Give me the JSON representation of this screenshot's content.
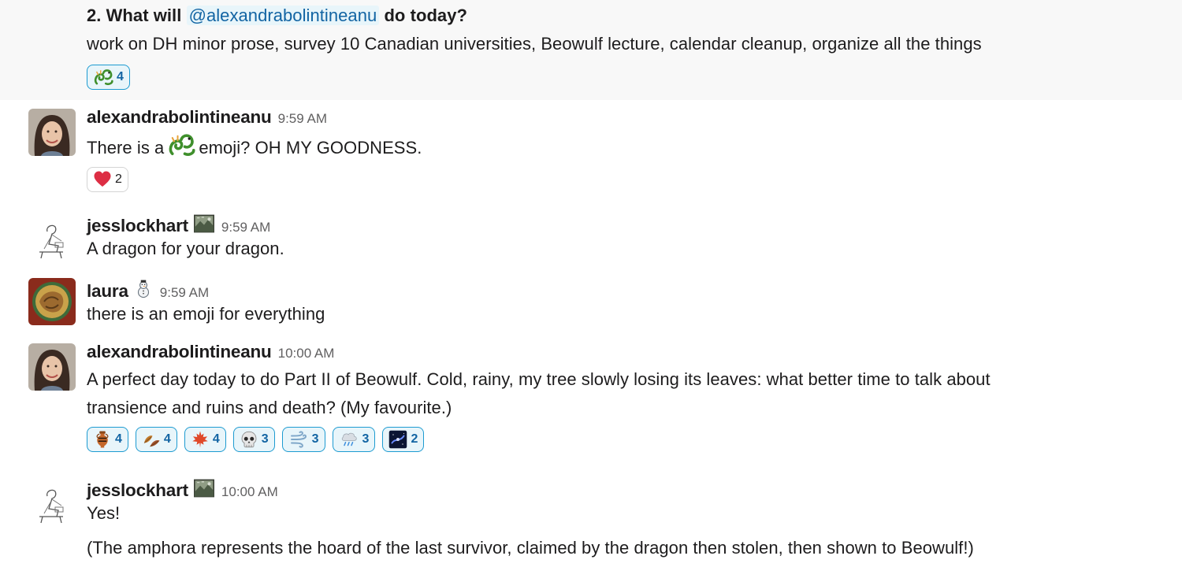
{
  "messages": [
    {
      "line1": "2. What will ",
      "mention": "@alexandrabolintineanu",
      "line1_end": " do today?",
      "line2": "work on DH minor prose, survey 10 Canadian universities, Beowulf lecture, calendar cleanup, organize all the things",
      "reactions": [
        {
          "icon": "dragon-icon",
          "count": "4"
        }
      ]
    },
    {
      "author": "alexandrabolintineanu",
      "time": "9:59 AM",
      "text_before": "There is a",
      "text_after": "emoji?  OH MY GOODNESS.",
      "inline_icon": "dragon-icon",
      "reactions": [
        {
          "icon": "heart-icon",
          "count": "2"
        }
      ]
    },
    {
      "author": "jesslockhart",
      "author_icon": "landscape-icon",
      "time": "9:59 AM",
      "text": "A dragon for your dragon."
    },
    {
      "author": "laura",
      "author_icon": "snowman-icon",
      "time": "9:59 AM",
      "text": "there is an emoji for everything"
    },
    {
      "author": "alexandrabolintineanu",
      "time": "10:00 AM",
      "line1": "A perfect day today to do Part II of Beowulf.   Cold, rainy, my tree slowly losing its leaves:   what better time to talk about",
      "line2": "transience and ruins and death?  (My favourite.)",
      "reactions": [
        {
          "icon": "amphora-icon",
          "count": "4"
        },
        {
          "icon": "fallen-leaf-icon",
          "count": "4"
        },
        {
          "icon": "maple-leaf-icon",
          "count": "4"
        },
        {
          "icon": "skull-icon",
          "count": "3"
        },
        {
          "icon": "wind-icon",
          "count": "3"
        },
        {
          "icon": "rain-cloud-icon",
          "count": "3"
        },
        {
          "icon": "galaxy-icon",
          "count": "2"
        }
      ]
    },
    {
      "author": "jesslockhart",
      "author_icon": "landscape-icon",
      "time": "10:00 AM",
      "line1": "Yes!",
      "line2": "(The amphora represents the hoard of the last survivor, claimed by the dragon then stolen, then shown to Beowulf!)"
    }
  ],
  "colors": {
    "mention": "#1264a3",
    "reaction_highlight": "#1d9bd1",
    "timestamp": "#616061"
  }
}
